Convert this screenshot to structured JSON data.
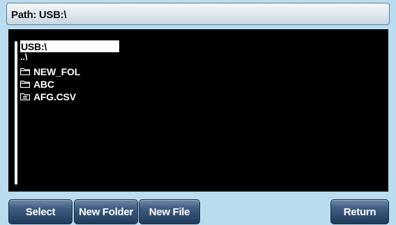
{
  "path_bar": {
    "label": "Path: USB:\\"
  },
  "browser": {
    "selected_entry": "USB:\\",
    "parent_entry": "..\\",
    "items": [
      {
        "name": "NEW_FOL",
        "icon": "folder-icon"
      },
      {
        "name": "ABC",
        "icon": "folder-icon"
      },
      {
        "name": "AFG.CSV",
        "icon": "file-icon"
      }
    ]
  },
  "softkeys": {
    "select": "Select",
    "new_folder": "New Folder",
    "new_file": "New File",
    "return": "Return"
  },
  "colors": {
    "screen_background": "#b9dcee",
    "browser_background": "#000000",
    "softkey_dark": "#1f3b5c",
    "softkey_light": "#6e8aa8"
  }
}
